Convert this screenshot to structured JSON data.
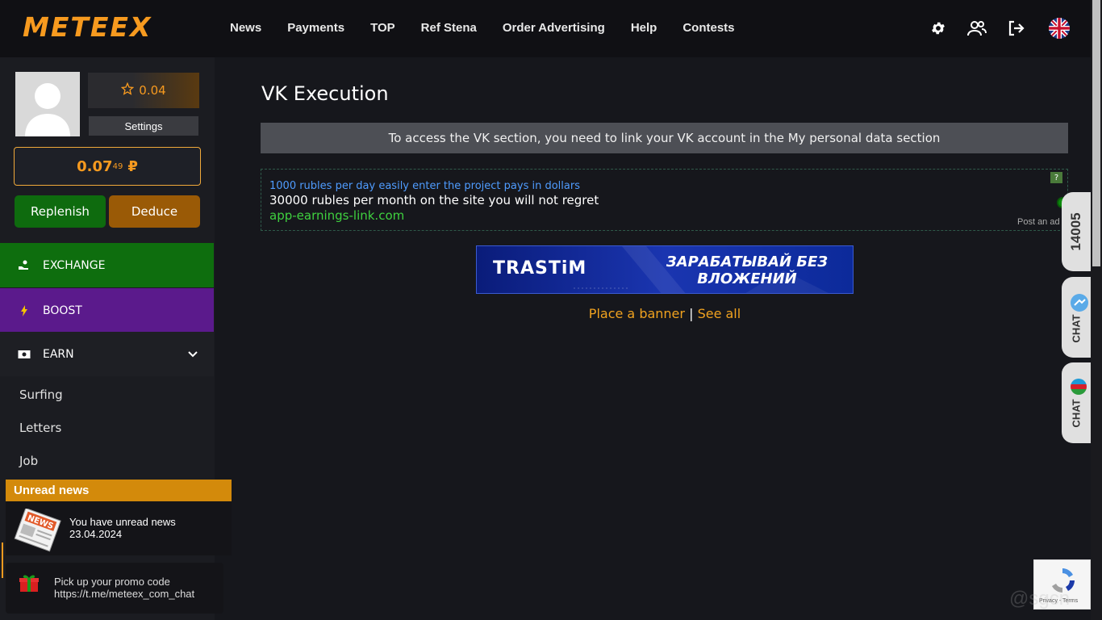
{
  "header": {
    "logo": "METEEX",
    "nav": [
      "News",
      "Payments",
      "TOP",
      "Ref Stena",
      "Order Advertising",
      "Help",
      "Contests"
    ]
  },
  "sidebar": {
    "rating": "0.04",
    "settings_label": "Settings",
    "balance_main": "0.07",
    "balance_fraction": "49",
    "balance_currency": "₽",
    "replenish_label": "Replenish",
    "deduce_label": "Deduce",
    "menu": {
      "exchange": "EXCHANGE",
      "boost": "BOOST",
      "earn": "EARN"
    },
    "earn_items": [
      "Surfing",
      "Letters",
      "Job"
    ]
  },
  "news_popup": {
    "header": "Unread news",
    "line1": "You have unread news",
    "date": "23.04.2024",
    "image_text": "NEWS"
  },
  "promo": {
    "line1": "Pick up your promo code",
    "line2": "https://t.me/meteex_com_chat"
  },
  "main": {
    "title": "VK Execution",
    "notice": "To access the VK section, you need to link your VK account in the My personal data section",
    "ad": {
      "title": "1000 rubles per day easily enter the project pays in dollars",
      "description": "30000 rubles per month on the site you will not regret",
      "link": "app-earnings-link.com",
      "help": "?",
      "post": "Post an ad"
    },
    "banner": {
      "brand": "TRASTiM",
      "slogan_line1": "ЗАРАБАТЫВАЙ БЕЗ",
      "slogan_line2": "ВЛОЖЕНИЙ"
    },
    "place_banner": "Place a banner",
    "separator": "|",
    "see_all": "See all"
  },
  "right_tabs": {
    "counter": "14005",
    "chat1": "CHAT",
    "chat2": "CHAT"
  },
  "recaptcha": {
    "text": "Privacy - Terms"
  },
  "watermark": "@sgcn",
  "colors": {
    "accent": "#f79a1f",
    "exchange": "#0e6e0e",
    "boost": "#5b1a8c",
    "deduce": "#9a5a06"
  }
}
